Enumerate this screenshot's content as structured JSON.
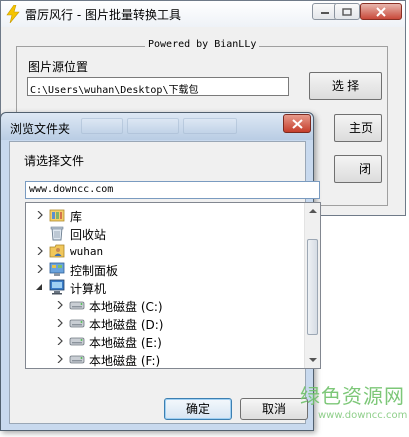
{
  "main_window": {
    "title": "雷厉风行 - 图片批量转换工具",
    "group_title": "Powered by BianLLy",
    "source_label": "图片源位置",
    "source_path": "C:\\Users\\wuhan\\Desktop\\下载包",
    "select_button": "选 择",
    "home_button": "主页",
    "exit_button": "闭"
  },
  "dialog": {
    "title": "浏览文件夹",
    "prompt": "请选择文件",
    "url_value": "www.downcc.com",
    "tree": [
      {
        "label": "库",
        "icon": "library-icon",
        "expander": "collapsed"
      },
      {
        "label": "回收站",
        "icon": "recycle-bin-icon",
        "expander": "none"
      },
      {
        "label": "wuhan",
        "icon": "user-folder-icon",
        "expander": "collapsed"
      },
      {
        "label": "控制面板",
        "icon": "control-panel-icon",
        "expander": "collapsed"
      },
      {
        "label": "计算机",
        "icon": "computer-icon",
        "expander": "expanded"
      },
      {
        "label": "本地磁盘 (C:)",
        "icon": "drive-icon",
        "expander": "collapsed"
      },
      {
        "label": "本地磁盘 (D:)",
        "icon": "drive-icon",
        "expander": "collapsed"
      },
      {
        "label": "本地磁盘 (E:)",
        "icon": "drive-icon",
        "expander": "collapsed"
      },
      {
        "label": "本地磁盘 (F:)",
        "icon": "drive-icon",
        "expander": "collapsed"
      }
    ],
    "ok_button": "确定",
    "cancel_button": "取消"
  },
  "watermark": {
    "text": "绿色资源网",
    "url": "www.downcc.com"
  },
  "colors": {
    "dialog_frame": "#c8d9ee",
    "close_button": "#c53e2c",
    "watermark": "#6fc26a"
  }
}
